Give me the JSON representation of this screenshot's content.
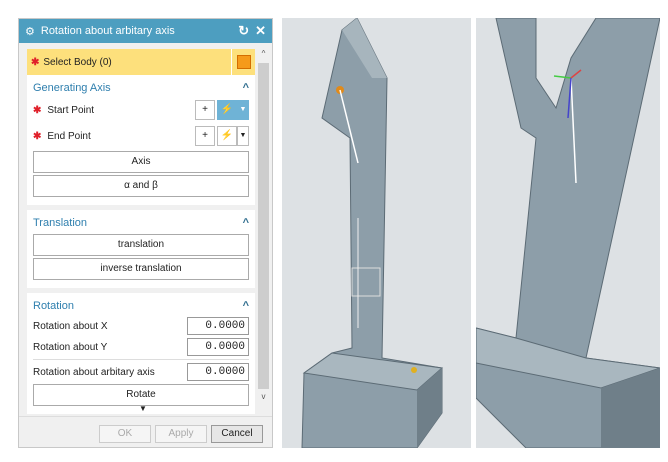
{
  "dialog": {
    "title": "Rotation about arbitary axis",
    "select_body": "Select Body (0)",
    "generating_axis": {
      "header": "Generating Axis",
      "start_point": "Start Point",
      "end_point": "End Point",
      "axis_button": "Axis",
      "alpha_beta_button": "α and β"
    },
    "translation": {
      "header": "Translation",
      "translation_button": "translation",
      "inverse_button": "inverse translation"
    },
    "rotation": {
      "header": "Rotation",
      "about_x_label": "Rotation about X",
      "about_x_value": "0.0000",
      "about_y_label": "Rotation about Y",
      "about_y_value": "0.0000",
      "about_axis_label": "Rotation about arbitary axis",
      "about_axis_value": "0.0000",
      "rotate_button": "Rotate"
    },
    "footer": {
      "ok": "OK",
      "apply": "Apply",
      "cancel": "Cancel"
    }
  },
  "colors": {
    "title_bar": "#4d9ec0",
    "highlight": "#fde07c",
    "required": "#e0202a"
  }
}
